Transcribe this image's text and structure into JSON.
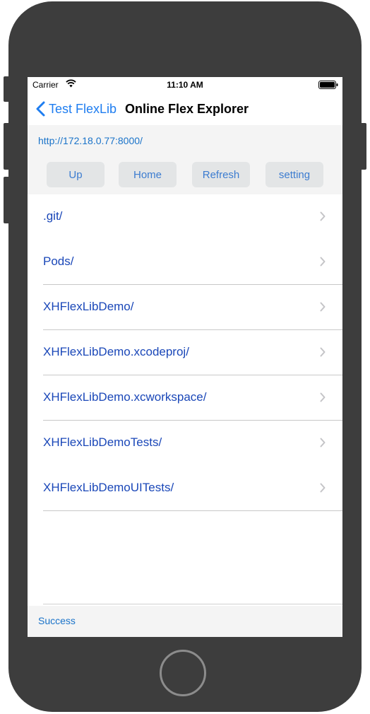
{
  "status_bar": {
    "carrier": "Carrier",
    "time": "11:10 AM",
    "icons": [
      "wifi-icon",
      "battery-icon"
    ]
  },
  "nav": {
    "back_label": "Test FlexLib",
    "title": "Online Flex Explorer",
    "accent_color": "#1e7df0"
  },
  "toolbar": {
    "url": "http://172.18.0.77:8000/",
    "buttons": [
      {
        "label": "Up"
      },
      {
        "label": "Home"
      },
      {
        "label": "Refresh"
      },
      {
        "label": "setting"
      }
    ]
  },
  "files": [
    {
      "name": ".git/"
    },
    {
      "name": "Pods/"
    },
    {
      "name": "XHFlexLibDemo/"
    },
    {
      "name": "XHFlexLibDemo.xcodeproj/"
    },
    {
      "name": "XHFlexLibDemo.xcworkspace/"
    },
    {
      "name": "XHFlexLibDemoTests/"
    },
    {
      "name": "XHFlexLibDemoUITests/"
    }
  ],
  "footer": {
    "status": "Success"
  },
  "colors": {
    "link": "#1a47b8",
    "url": "#1a73c9",
    "toolbar_bg": "#f4f4f4",
    "button_bg": "#e3e5e6"
  }
}
